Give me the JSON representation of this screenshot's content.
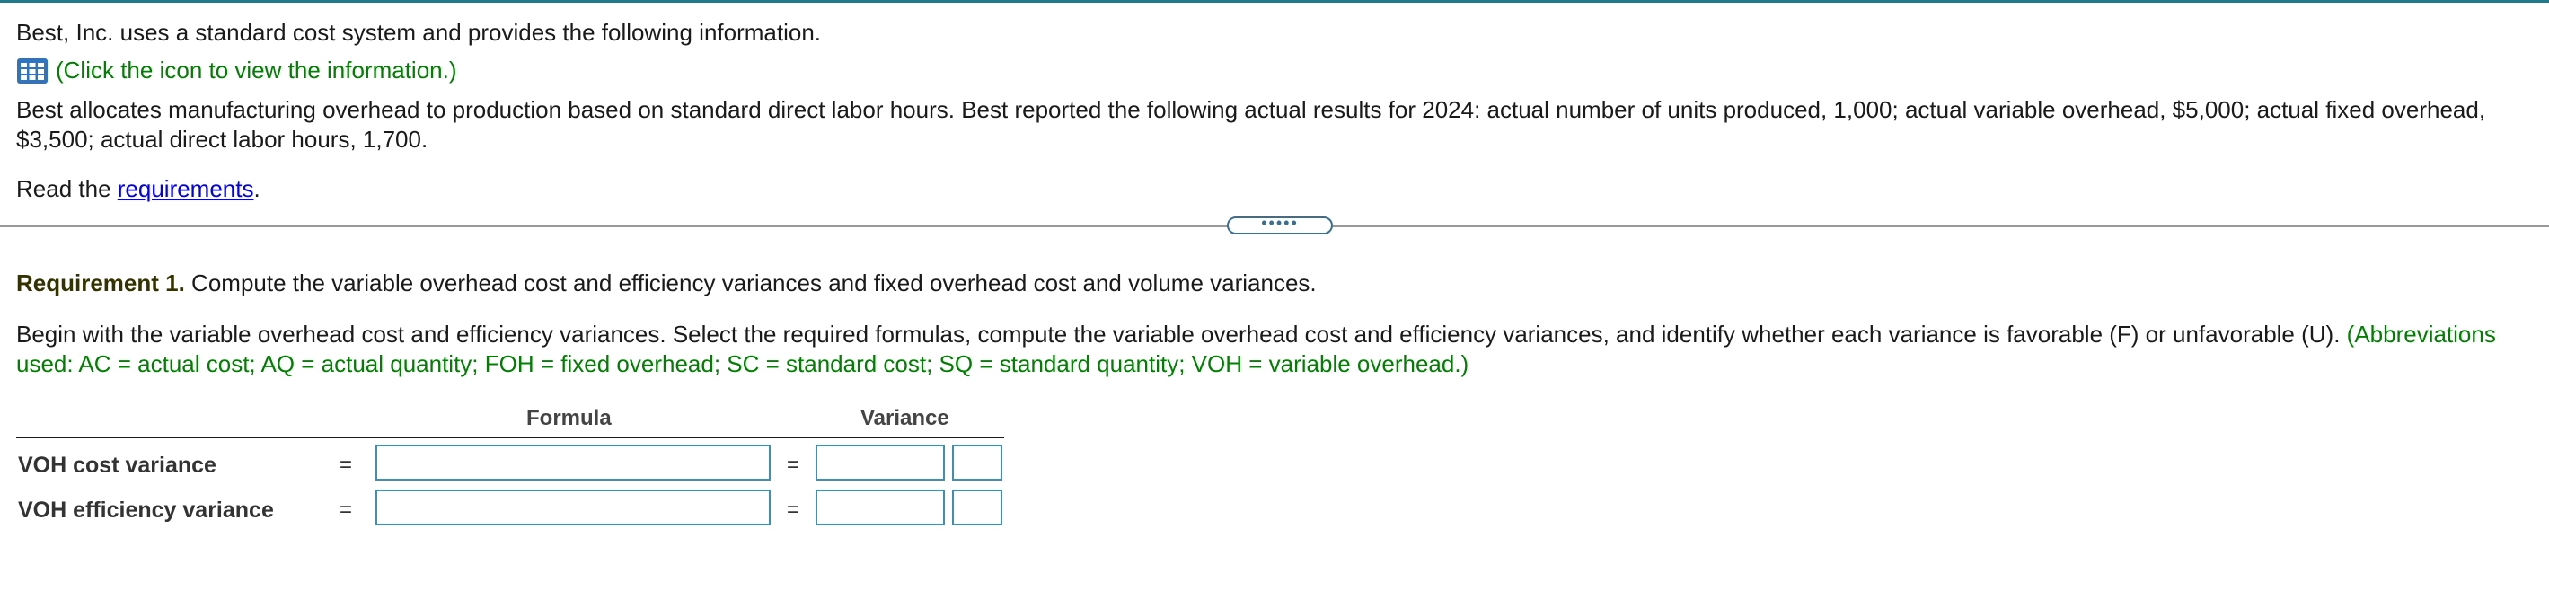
{
  "intro": "Best, Inc. uses a standard cost system and provides the following information.",
  "icon_link": {
    "icon": "table-grid-icon",
    "text": "(Click the icon to view the information.)"
  },
  "paragraph_line1": "Best allocates manufacturing overhead to production based on standard direct labor hours. Best reported the following actual results for 2024: actual number of units produced, 1,000; actual variable overhead, $5,000; actual fixed overhead,",
  "paragraph_line2": "$3,500; actual direct labor hours, 1,700.",
  "read": {
    "prefix": "Read the ",
    "link": "requirements",
    "suffix": "."
  },
  "divider_handle": "•••••",
  "requirement": {
    "label": "Requirement 1.",
    "text": " Compute the variable overhead cost and efficiency variances and fixed overhead cost and volume variances."
  },
  "instructions": {
    "line1_black": "Begin with the variable overhead cost and efficiency variances. Select the required formulas, compute the variable overhead cost and efficiency variances, and identify whether each variance is favorable (F) or unfavorable (U).",
    "line1_green": " (Abbreviations",
    "line2_green": "used: AC = actual cost; AQ = actual quantity; FOH = fixed overhead; SC = standard cost; SQ = standard quantity; VOH = variable overhead.)"
  },
  "table": {
    "headers": {
      "formula": "Formula",
      "variance": "Variance"
    },
    "rows": [
      {
        "label": "VOH cost variance",
        "eq1": "=",
        "eq2": "=",
        "formula": "",
        "variance": "",
        "fu": ""
      },
      {
        "label": "VOH efficiency variance",
        "eq1": "=",
        "eq2": "=",
        "formula": "",
        "variance": "",
        "fu": ""
      }
    ]
  },
  "colors": {
    "accent": "#3f8fb3",
    "green_text": "#008000",
    "link": "#0000ee",
    "top_bar": "#1f7a8c"
  }
}
